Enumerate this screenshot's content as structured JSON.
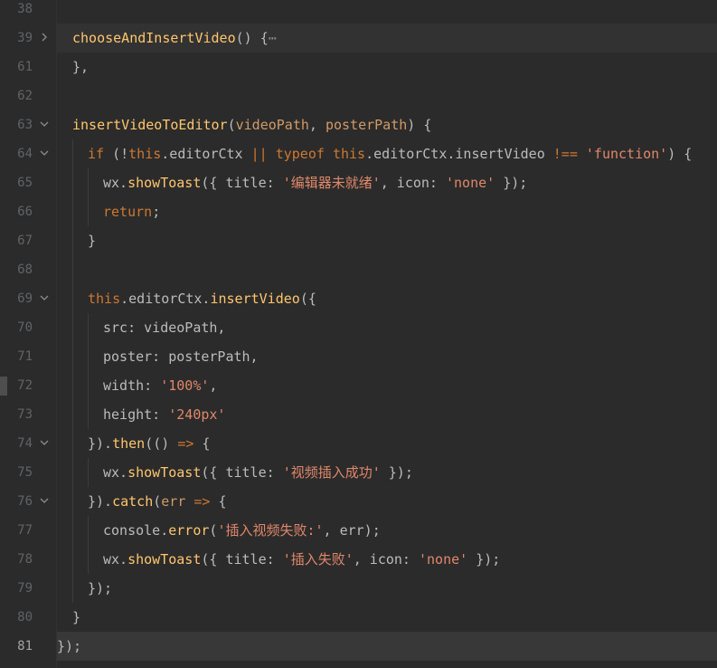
{
  "editor": {
    "colors": {
      "background": "#2b2b2b",
      "function": "#ffc66d",
      "keyword": "#cc7832",
      "string": "#e0876a",
      "text": "#bbbbbb",
      "line_number": "#606366"
    },
    "lines": [
      {
        "num": "38",
        "fold": "",
        "segments": []
      },
      {
        "num": "39",
        "fold": "collapsed",
        "segments": [
          {
            "t": "chooseAndInsertVideo",
            "c": "fn"
          },
          {
            "t": "() {",
            "c": "punc"
          },
          {
            "t": "⋯",
            "c": "fold-dots"
          }
        ]
      },
      {
        "num": "61",
        "fold": "",
        "segments": [
          {
            "t": "},",
            "c": "punc"
          }
        ]
      },
      {
        "num": "62",
        "fold": "",
        "segments": []
      },
      {
        "num": "63",
        "fold": "expanded",
        "segments": [
          {
            "t": "insertVideoToEditor",
            "c": "fn"
          },
          {
            "t": "(",
            "c": "punc"
          },
          {
            "t": "videoPath",
            "c": "param"
          },
          {
            "t": ", ",
            "c": "punc"
          },
          {
            "t": "posterPath",
            "c": "param"
          },
          {
            "t": ") {",
            "c": "punc"
          }
        ]
      },
      {
        "num": "64",
        "fold": "expanded",
        "segments": [
          {
            "t": "if",
            "c": "kw"
          },
          {
            "t": " (!",
            "c": "punc"
          },
          {
            "t": "this",
            "c": "kw-this"
          },
          {
            "t": ".editorCtx ",
            "c": "ident"
          },
          {
            "t": "||",
            "c": "op"
          },
          {
            "t": " ",
            "c": "punc"
          },
          {
            "t": "typeof",
            "c": "kw"
          },
          {
            "t": " ",
            "c": "punc"
          },
          {
            "t": "this",
            "c": "kw-this"
          },
          {
            "t": ".editorCtx.insertVideo ",
            "c": "ident"
          },
          {
            "t": "!==",
            "c": "op"
          },
          {
            "t": " ",
            "c": "punc"
          },
          {
            "t": "'function'",
            "c": "str-warm"
          },
          {
            "t": ") {",
            "c": "punc"
          }
        ]
      },
      {
        "num": "65",
        "fold": "",
        "segments": [
          {
            "t": "wx.",
            "c": "ident"
          },
          {
            "t": "showToast",
            "c": "fn"
          },
          {
            "t": "({ title: ",
            "c": "punc"
          },
          {
            "t": "'编辑器未就绪'",
            "c": "str-warm"
          },
          {
            "t": ", icon: ",
            "c": "punc"
          },
          {
            "t": "'none'",
            "c": "str-warm"
          },
          {
            "t": " });",
            "c": "punc"
          }
        ]
      },
      {
        "num": "66",
        "fold": "",
        "segments": [
          {
            "t": "return",
            "c": "kw"
          },
          {
            "t": ";",
            "c": "punc"
          }
        ]
      },
      {
        "num": "67",
        "fold": "",
        "segments": [
          {
            "t": "}",
            "c": "punc"
          }
        ]
      },
      {
        "num": "68",
        "fold": "",
        "segments": []
      },
      {
        "num": "69",
        "fold": "expanded",
        "segments": [
          {
            "t": "this",
            "c": "kw-this"
          },
          {
            "t": ".editorCtx.",
            "c": "ident"
          },
          {
            "t": "insertVideo",
            "c": "fn"
          },
          {
            "t": "({",
            "c": "punc"
          }
        ]
      },
      {
        "num": "70",
        "fold": "",
        "segments": [
          {
            "t": "src: videoPath,",
            "c": "ident"
          }
        ]
      },
      {
        "num": "71",
        "fold": "",
        "segments": [
          {
            "t": "poster: posterPath,",
            "c": "ident"
          }
        ]
      },
      {
        "num": "72",
        "fold": "",
        "segments": [
          {
            "t": "width: ",
            "c": "ident"
          },
          {
            "t": "'100%'",
            "c": "str-warm"
          },
          {
            "t": ",",
            "c": "punc"
          }
        ]
      },
      {
        "num": "73",
        "fold": "",
        "segments": [
          {
            "t": "height: ",
            "c": "ident"
          },
          {
            "t": "'240px'",
            "c": "str-warm"
          }
        ]
      },
      {
        "num": "74",
        "fold": "expanded",
        "segments": [
          {
            "t": "}).",
            "c": "punc"
          },
          {
            "t": "then",
            "c": "fn"
          },
          {
            "t": "(() ",
            "c": "punc"
          },
          {
            "t": "=>",
            "c": "op"
          },
          {
            "t": " {",
            "c": "punc"
          }
        ]
      },
      {
        "num": "75",
        "fold": "",
        "segments": [
          {
            "t": "wx.",
            "c": "ident"
          },
          {
            "t": "showToast",
            "c": "fn"
          },
          {
            "t": "({ title: ",
            "c": "punc"
          },
          {
            "t": "'视频插入成功'",
            "c": "str-warm"
          },
          {
            "t": " });",
            "c": "punc"
          }
        ]
      },
      {
        "num": "76",
        "fold": "expanded",
        "segments": [
          {
            "t": "}).",
            "c": "punc"
          },
          {
            "t": "catch",
            "c": "fn"
          },
          {
            "t": "(",
            "c": "punc"
          },
          {
            "t": "err",
            "c": "param"
          },
          {
            "t": " ",
            "c": "punc"
          },
          {
            "t": "=>",
            "c": "op"
          },
          {
            "t": " {",
            "c": "punc"
          }
        ]
      },
      {
        "num": "77",
        "fold": "",
        "segments": [
          {
            "t": "console.",
            "c": "ident"
          },
          {
            "t": "error",
            "c": "fn"
          },
          {
            "t": "(",
            "c": "punc"
          },
          {
            "t": "'插入视频失败:'",
            "c": "str-warm"
          },
          {
            "t": ", err);",
            "c": "punc"
          }
        ]
      },
      {
        "num": "78",
        "fold": "",
        "segments": [
          {
            "t": "wx.",
            "c": "ident"
          },
          {
            "t": "showToast",
            "c": "fn"
          },
          {
            "t": "({ title: ",
            "c": "punc"
          },
          {
            "t": "'插入失败'",
            "c": "str-warm"
          },
          {
            "t": ", icon: ",
            "c": "punc"
          },
          {
            "t": "'none'",
            "c": "str-warm"
          },
          {
            "t": " });",
            "c": "punc"
          }
        ]
      },
      {
        "num": "79",
        "fold": "",
        "segments": [
          {
            "t": "});",
            "c": "punc"
          }
        ]
      },
      {
        "num": "80",
        "fold": "",
        "segments": [
          {
            "t": "}",
            "c": "punc"
          }
        ]
      },
      {
        "num": "81",
        "fold": "",
        "segments": [
          {
            "t": "});",
            "c": "punc"
          }
        ]
      }
    ]
  }
}
